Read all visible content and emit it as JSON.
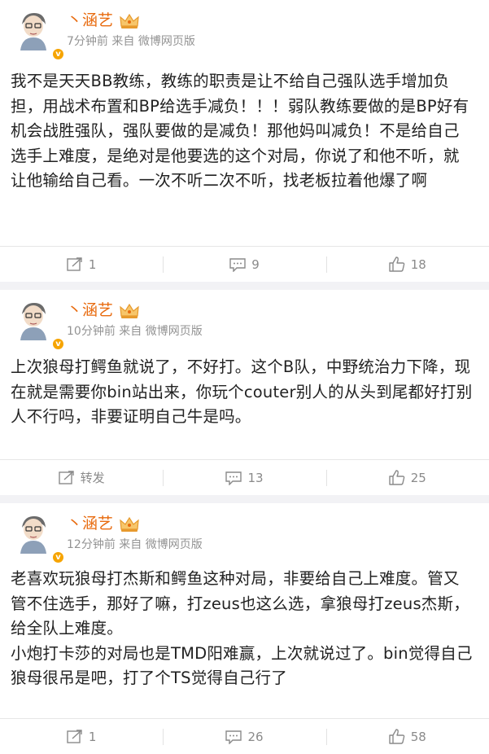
{
  "colors": {
    "username": "#e86b0f",
    "meta": "#939393",
    "text": "#222222",
    "action": "#8a8a8a",
    "background": "#f2f2f5"
  },
  "posts": [
    {
      "username": "丶涵艺",
      "time": "7分钟前",
      "source": "来自 微博网页版",
      "paragraphs": [
        "我不是天天BB教练，教练的职责是让不给自己强队选手增加负担，用战术布置和BP给选手减负！！！弱队教练要做的是BP好有机会战胜强队，强队要做的是减负！那他妈叫减负！不是给自己选手上难度，是绝对是他要选的这个对局，你说了和他不听，就让他输给自己看。一次不听二次不听，找老板拉着他爆了啊"
      ],
      "repost": "1",
      "comments": "9",
      "likes": "18"
    },
    {
      "username": "丶涵艺",
      "time": "10分钟前",
      "source": "来自 微博网页版",
      "paragraphs": [
        "上次狼母打鳄鱼就说了，不好打。这个B队，中野统治力下降，现在就是需要你bin站出来，你玩个couter别人的从头到尾都好打别人不行吗，非要证明自己牛是吗。"
      ],
      "repost": "转发",
      "comments": "13",
      "likes": "25"
    },
    {
      "username": "丶涵艺",
      "time": "12分钟前",
      "source": "来自 微博网页版",
      "paragraphs": [
        "老喜欢玩狼母打杰斯和鳄鱼这种对局，非要给自己上难度。管又管不住选手，那好了嘛，打zeus也这么选，拿狼母打zeus杰斯，给全队上难度。",
        "小炮打卡莎的对局也是TMD阳难赢，上次就说过了。bin觉得自己狼母很吊是吧，打了个TS觉得自己行了"
      ],
      "repost": "1",
      "comments": "26",
      "likes": "58"
    }
  ]
}
